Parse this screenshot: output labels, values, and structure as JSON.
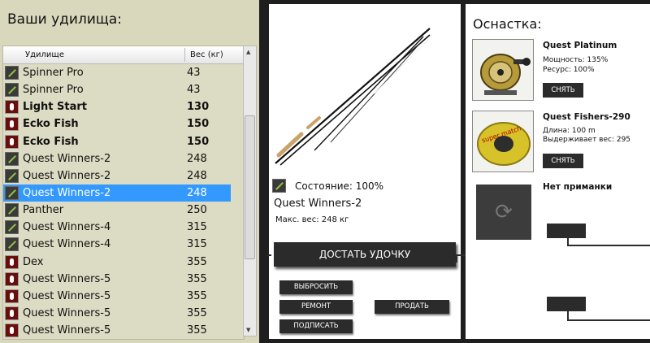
{
  "left": {
    "title": "Ваши удилища:",
    "columns": {
      "name": "Удилище",
      "weight": "Вес (кг)"
    },
    "rows": [
      {
        "icon": "rod-icon",
        "name": "Spinner Pro",
        "weight": "43",
        "bold": false,
        "selected": false
      },
      {
        "icon": "rod-icon",
        "name": "Spinner Pro",
        "weight": "43",
        "bold": false,
        "selected": false
      },
      {
        "icon": "lure-icon",
        "name": "Light Start",
        "weight": "130",
        "bold": true,
        "selected": false
      },
      {
        "icon": "lure-icon",
        "name": "Ecko Fish",
        "weight": "150",
        "bold": true,
        "selected": false
      },
      {
        "icon": "lure-icon",
        "name": "Ecko Fish",
        "weight": "150",
        "bold": true,
        "selected": false
      },
      {
        "icon": "rod-icon",
        "name": "Quest Winners-2",
        "weight": "248",
        "bold": false,
        "selected": false
      },
      {
        "icon": "rod-icon",
        "name": "Quest Winners-2",
        "weight": "248",
        "bold": false,
        "selected": false
      },
      {
        "icon": "rod-icon",
        "name": "Quest Winners-2",
        "weight": "248",
        "bold": false,
        "selected": true
      },
      {
        "icon": "rod-icon",
        "name": "Panther",
        "weight": "250",
        "bold": false,
        "selected": false
      },
      {
        "icon": "rod-icon",
        "name": "Quest Winners-4",
        "weight": "315",
        "bold": false,
        "selected": false
      },
      {
        "icon": "rod-icon",
        "name": "Quest Winners-4",
        "weight": "315",
        "bold": false,
        "selected": false
      },
      {
        "icon": "lure-icon",
        "name": "Dex",
        "weight": "355",
        "bold": false,
        "selected": false
      },
      {
        "icon": "lure-icon",
        "name": "Quest Winners-5",
        "weight": "355",
        "bold": false,
        "selected": false
      },
      {
        "icon": "lure-icon",
        "name": "Quest Winners-5",
        "weight": "355",
        "bold": false,
        "selected": false
      },
      {
        "icon": "lure-icon",
        "name": "Quest Winners-5",
        "weight": "355",
        "bold": false,
        "selected": false
      },
      {
        "icon": "lure-icon",
        "name": "Quest Winners-5",
        "weight": "355",
        "bold": false,
        "selected": false
      }
    ]
  },
  "middle": {
    "state": "Состояние: 100%",
    "rod_name": "Quest Winners-2",
    "max_weight": "Макс. вес: 248 кг",
    "take_button": "ДОСТАТЬ УДОЧКУ",
    "throw_button": "ВЫБРОСИТЬ",
    "repair_button": "РЕМОНТ",
    "sell_button": "ПРОДАТЬ",
    "sign_button": "ПОДПИСАТЬ"
  },
  "right": {
    "title": "Оснастка:",
    "reel": {
      "name": "Quest Platinum",
      "power": "Мощность: 135%",
      "resource": "Ресурс: 100%",
      "remove": "СНЯТЬ"
    },
    "line": {
      "name": "Quest Fishers-290",
      "length": "Длина: 100 m",
      "holds": "Выдерживает вес: 295",
      "remove": "СНЯТЬ",
      "label_text": "super match"
    },
    "lure": {
      "name": "Нет приманки"
    }
  },
  "colors": {
    "panel_left": "#d9d8bd",
    "selection": "#3399ff",
    "button": "#2b2b2b",
    "frame": "#1e1e1e"
  }
}
